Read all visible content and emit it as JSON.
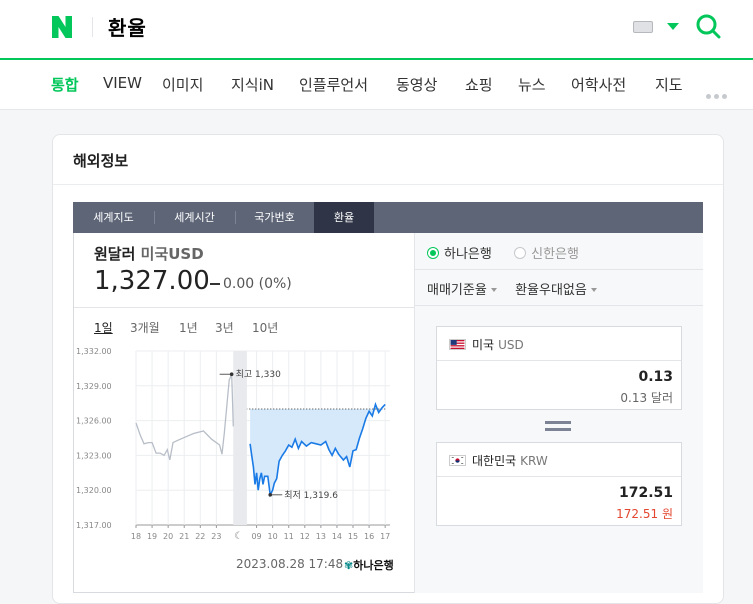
{
  "header": {
    "logo": "N",
    "query": "환율"
  },
  "nav_tabs": [
    {
      "label": "통합",
      "active": true
    },
    {
      "label": "VIEW",
      "active": false
    },
    {
      "label": "이미지",
      "active": false
    },
    {
      "label": "지식iN",
      "active": false
    },
    {
      "label": "인플루언서",
      "active": false
    },
    {
      "label": "동영상",
      "active": false
    },
    {
      "label": "쇼핑",
      "active": false
    },
    {
      "label": "뉴스",
      "active": false
    },
    {
      "label": "어학사전",
      "active": false
    },
    {
      "label": "지도",
      "active": false
    }
  ],
  "card": {
    "title": "해외정보",
    "subtabs": [
      "세계지도",
      "세계시간",
      "국가번호",
      "환율"
    ],
    "selected_subtab": "환율"
  },
  "rate": {
    "name": "원달러",
    "country_code": "미국USD",
    "value": "1,327.00",
    "change": "0.00",
    "change_pct": "(0%)"
  },
  "periods": [
    "1일",
    "3개월",
    "1년",
    "3년",
    "10년"
  ],
  "selected_period": "1일",
  "chart_data": {
    "type": "line",
    "ylim": [
      1317,
      1332
    ],
    "y_ticks": [
      "1,332.00",
      "1,329.00",
      "1,326.00",
      "1,323.00",
      "1,320.00",
      "1,317.00"
    ],
    "x_ticks_prev": [
      "18",
      "19",
      "20",
      "21",
      "22",
      "23"
    ],
    "x_ticks_today": [
      "09",
      "10",
      "11",
      "12",
      "13",
      "14",
      "15",
      "16",
      "17"
    ],
    "max_label": "최고 1,330",
    "min_label": "최저 1,319.6",
    "prev_series": [
      [
        0,
        1325.8
      ],
      [
        0.25,
        1324.8
      ],
      [
        0.5,
        1324
      ],
      [
        0.75,
        1324.1
      ],
      [
        1,
        1324.1
      ],
      [
        1.25,
        1323.2
      ],
      [
        1.5,
        1323.2
      ],
      [
        1.75,
        1323
      ],
      [
        1.95,
        1323.5
      ],
      [
        2.1,
        1322.6
      ],
      [
        2.3,
        1324.1
      ],
      [
        2.6,
        1324.3
      ],
      [
        3.1,
        1324.6
      ],
      [
        3.6,
        1324.9
      ],
      [
        4.2,
        1325.1
      ],
      [
        4.7,
        1324.4
      ],
      [
        5.2,
        1323.9
      ],
      [
        5.35,
        1323.1
      ],
      [
        5.5,
        1325
      ],
      [
        5.8,
        1329.5
      ],
      [
        5.95,
        1330
      ],
      [
        6.05,
        1325.5
      ]
    ],
    "today_series": [
      [
        7.1,
        1324
      ],
      [
        7.2,
        1323
      ],
      [
        7.3,
        1322
      ],
      [
        7.4,
        1320.5
      ],
      [
        7.5,
        1321.5
      ],
      [
        7.6,
        1320
      ],
      [
        7.7,
        1321
      ],
      [
        7.8,
        1321.5
      ],
      [
        7.9,
        1320.5
      ],
      [
        8,
        1321.2
      ],
      [
        8.2,
        1321.2
      ],
      [
        8.35,
        1319.6
      ],
      [
        8.5,
        1320
      ],
      [
        8.6,
        1320.6
      ],
      [
        8.75,
        1321
      ],
      [
        8.9,
        1322.5
      ],
      [
        9.1,
        1323
      ],
      [
        9.3,
        1323.4
      ],
      [
        9.5,
        1323.9
      ],
      [
        9.7,
        1323.7
      ],
      [
        9.9,
        1324.4
      ],
      [
        10.1,
        1323.6
      ],
      [
        10.3,
        1324.2
      ],
      [
        10.6,
        1323.8
      ],
      [
        10.9,
        1324.1
      ],
      [
        11.2,
        1324
      ],
      [
        11.5,
        1323.9
      ],
      [
        11.8,
        1324.2
      ],
      [
        12,
        1323.5
      ],
      [
        12.2,
        1323
      ],
      [
        12.4,
        1323.6
      ],
      [
        12.6,
        1323.1
      ],
      [
        12.9,
        1322.6
      ],
      [
        13.1,
        1322.9
      ],
      [
        13.3,
        1322
      ],
      [
        13.5,
        1323.4
      ],
      [
        13.7,
        1323.5
      ],
      [
        13.9,
        1324.5
      ],
      [
        14.1,
        1325.3
      ],
      [
        14.3,
        1326.2
      ],
      [
        14.5,
        1326.8
      ],
      [
        14.7,
        1326.4
      ],
      [
        14.9,
        1327.4
      ],
      [
        15.1,
        1326.7
      ],
      [
        15.3,
        1327.1
      ],
      [
        15.5,
        1327.4
      ]
    ],
    "prev_close": 1327
  },
  "timestamp": "2023.08.28 17:48",
  "bank_logo": "하나은행",
  "banks": [
    {
      "label": "하나은행",
      "selected": true
    },
    {
      "label": "신한은행",
      "selected": false
    }
  ],
  "dropdowns": [
    "매매기준율",
    "환율우대없음"
  ],
  "converter": {
    "from": {
      "country": "미국",
      "code": "USD",
      "amount": "0.13",
      "unit_text": "0.13 달러"
    },
    "to": {
      "country": "대한민국",
      "code": "KRW",
      "amount": "172.51",
      "unit_text": "172.51 원"
    }
  },
  "colors": {
    "accent": "#03c75a",
    "line": "#1a7be6",
    "fill": "#d6e9fb",
    "prev_line": "#b8bec8"
  }
}
